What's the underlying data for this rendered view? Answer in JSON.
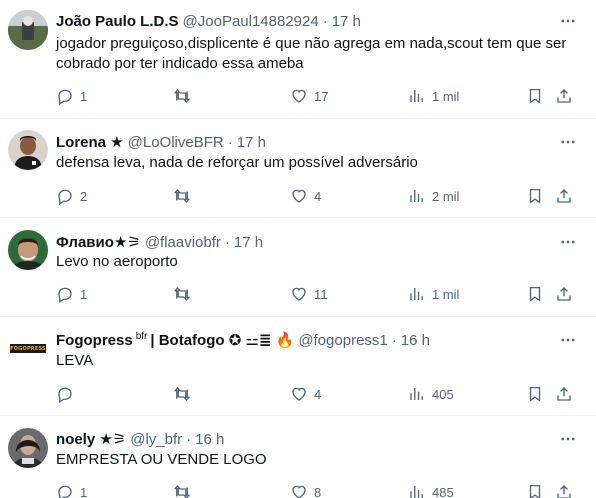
{
  "tweets": [
    {
      "name": "João Paulo L.D.S",
      "handle": "@JooPaul14882924",
      "time": "17 h",
      "text": "jogador preguiçoso,displicente é que não agrega em nada,scout tem que ser cobrado por ter indicado essa ameba",
      "replies": "1",
      "retweets": "",
      "likes": "17",
      "views": "1 mil"
    },
    {
      "name": "Lorena ★",
      "handle": "@LoOliveBFR",
      "time": "17 h",
      "text": "defensa leva, nada de reforçar um possível adversário",
      "replies": "2",
      "retweets": "",
      "likes": "4",
      "views": "2 mil"
    },
    {
      "name": "Флавио★⚞",
      "handle": "@flaaviobfr",
      "time": "17 h",
      "text": "Levo no aeroporto",
      "replies": "1",
      "retweets": "",
      "likes": "11",
      "views": "1 mil"
    },
    {
      "name": "Fogopress",
      "name_badge": "bfr",
      "name_suffix": "| Botafogo ✪ ⚍≣ 🔥",
      "handle": "@fogopress1",
      "time": "16 h",
      "text": "LEVA",
      "replies": "",
      "retweets": "",
      "likes": "4",
      "views": "405",
      "avatar_text": "FOGOPRESS"
    },
    {
      "name": "noely ★⚞",
      "handle": "@ly_bfr",
      "time": "16 h",
      "text": "EMPRESTA OU VENDE LOGO",
      "replies": "1",
      "retweets": "",
      "likes": "8",
      "views": "485"
    }
  ],
  "colors": {
    "text": "#0f1419",
    "secondary": "#536471",
    "border": "#eff3f4"
  },
  "icons": [
    "reply-icon",
    "retweet-icon",
    "like-icon",
    "views-icon",
    "bookmark-icon",
    "share-icon",
    "more-icon"
  ]
}
